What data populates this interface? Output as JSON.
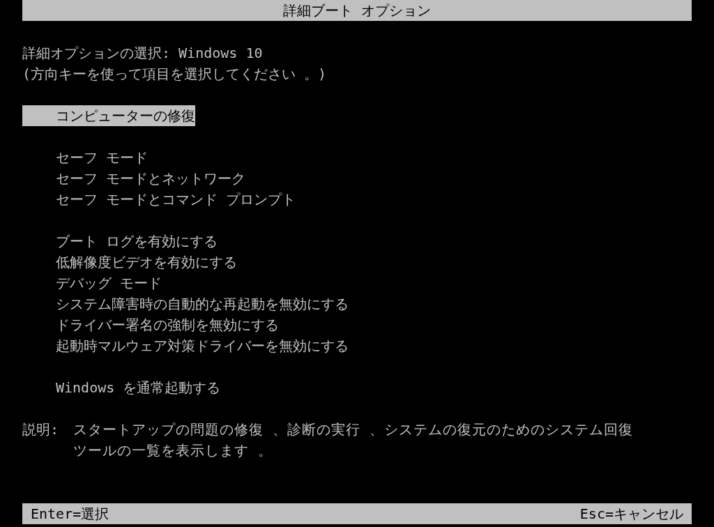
{
  "title": "詳細ブート オプション",
  "prompt": [
    "詳細オプションの選択: Windows 10",
    "(方向キーを使って項目を選択してください 。)"
  ],
  "menu_groups": [
    {
      "items": [
        {
          "label": "コンピューターの修復",
          "selected": true
        }
      ]
    },
    {
      "items": [
        {
          "label": "セーフ モード",
          "selected": false
        },
        {
          "label": "セーフ モードとネットワーク",
          "selected": false
        },
        {
          "label": "セーフ モードとコマンド プロンプト",
          "selected": false
        }
      ]
    },
    {
      "items": [
        {
          "label": "ブート ログを有効にする",
          "selected": false
        },
        {
          "label": "低解像度ビデオを有効にする",
          "selected": false
        },
        {
          "label": "デバッグ モード",
          "selected": false
        },
        {
          "label": "システム障害時の自動的な再起動を無効にする",
          "selected": false
        },
        {
          "label": "ドライバー署名の強制を無効にする",
          "selected": false
        },
        {
          "label": "起動時マルウェア対策ドライバーを無効にする",
          "selected": false
        }
      ]
    },
    {
      "items": [
        {
          "label": "Windows を通常起動する",
          "selected": false
        }
      ]
    }
  ],
  "description": {
    "label": "説明:",
    "text": "スタートアップの問題の修復 、診断の実行 、システムの復元のためのシステム回復ツールの一覧を表示します 。"
  },
  "footer": {
    "left": "Enter=選択",
    "right": "Esc=キャンセル"
  }
}
